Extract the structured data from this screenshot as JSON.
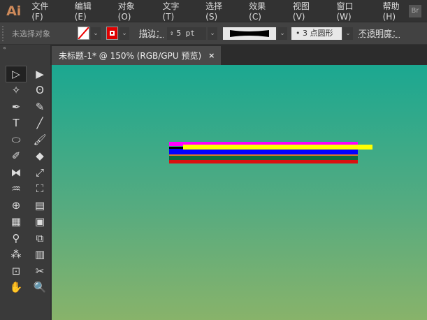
{
  "app": {
    "logo": "Ai",
    "bridge": "Br"
  },
  "menu": [
    "文件(F)",
    "编辑(E)",
    "对象(O)",
    "文字(T)",
    "选择(S)",
    "效果(C)",
    "视图(V)",
    "窗口(W)",
    "帮助(H)"
  ],
  "control": {
    "selection": "未选择对象",
    "stroke_label": "描边：",
    "stroke_weight": "5 pt",
    "brush": "• 3 点圆形",
    "opacity_label": "不透明度："
  },
  "colors": {
    "stroke": "#e00000",
    "fill": "none"
  },
  "tab": {
    "title": "未标题-1* @ 150% (RGB/GPU 预览)",
    "close": "×"
  },
  "tools": [
    {
      "name": "selection",
      "g": "▷"
    },
    {
      "name": "direct-selection",
      "g": "▶"
    },
    {
      "name": "magic-wand",
      "g": "✧"
    },
    {
      "name": "lasso",
      "g": "ʘ"
    },
    {
      "name": "pen",
      "g": "✒"
    },
    {
      "name": "curvature",
      "g": "✎"
    },
    {
      "name": "type",
      "g": "T"
    },
    {
      "name": "line",
      "g": "╱"
    },
    {
      "name": "ellipse",
      "g": "⬭"
    },
    {
      "name": "paintbrush",
      "g": "🖌"
    },
    {
      "name": "shaper",
      "g": "✐"
    },
    {
      "name": "eraser",
      "g": "◆"
    },
    {
      "name": "reflect",
      "g": "⧓"
    },
    {
      "name": "scale",
      "g": "⤢"
    },
    {
      "name": "warp",
      "g": "♒"
    },
    {
      "name": "free-transform",
      "g": "⛶"
    },
    {
      "name": "shape-builder",
      "g": "⊕"
    },
    {
      "name": "perspective",
      "g": "▤"
    },
    {
      "name": "mesh",
      "g": "▦"
    },
    {
      "name": "gradient",
      "g": "▣"
    },
    {
      "name": "eyedropper",
      "g": "⚲"
    },
    {
      "name": "blend",
      "g": "⧉"
    },
    {
      "name": "symbol-sprayer",
      "g": "⁂"
    },
    {
      "name": "column-graph",
      "g": "▥"
    },
    {
      "name": "artboard",
      "g": "⊡"
    },
    {
      "name": "slice",
      "g": "✂"
    },
    {
      "name": "hand",
      "g": "✋"
    },
    {
      "name": "zoom",
      "g": "🔍"
    }
  ],
  "strokes": [
    "#ff00ff",
    "#000000",
    "#0000ff",
    "#d9772a",
    "#0c6a3a",
    "#d81010",
    "#ffff00"
  ]
}
